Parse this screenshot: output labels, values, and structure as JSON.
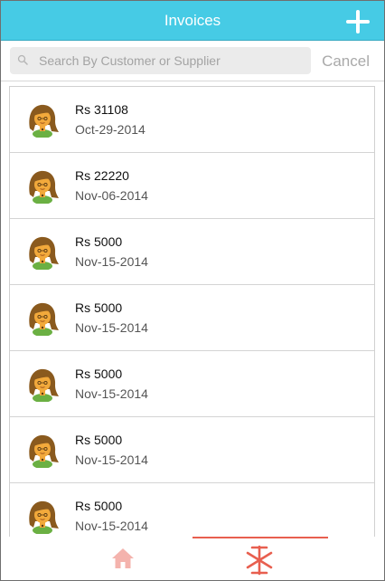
{
  "header": {
    "title": "Invoices",
    "add_icon": "plus-icon"
  },
  "search": {
    "placeholder": "Search By Customer or Supplier",
    "value": "",
    "cancel_label": "Cancel",
    "icon": "search-icon"
  },
  "invoices": [
    {
      "amount": "Rs 31108",
      "date": "Oct-29-2014"
    },
    {
      "amount": "Rs 22220",
      "date": "Nov-06-2014"
    },
    {
      "amount": "Rs 5000",
      "date": "Nov-15-2014"
    },
    {
      "amount": "Rs 5000",
      "date": "Nov-15-2014"
    },
    {
      "amount": "Rs 5000",
      "date": "Nov-15-2014"
    },
    {
      "amount": "Rs 5000",
      "date": "Nov-15-2014"
    },
    {
      "amount": "Rs 5000",
      "date": "Nov-15-2014"
    }
  ],
  "tabbar": {
    "tabs": [
      {
        "icon": "home-icon",
        "active": false
      },
      {
        "icon": "asterisk-icon",
        "active": true
      }
    ]
  },
  "colors": {
    "header_bg": "#46cbe5",
    "tab_accent": "#e85f4f",
    "home_icon": "#f4b3ad"
  }
}
